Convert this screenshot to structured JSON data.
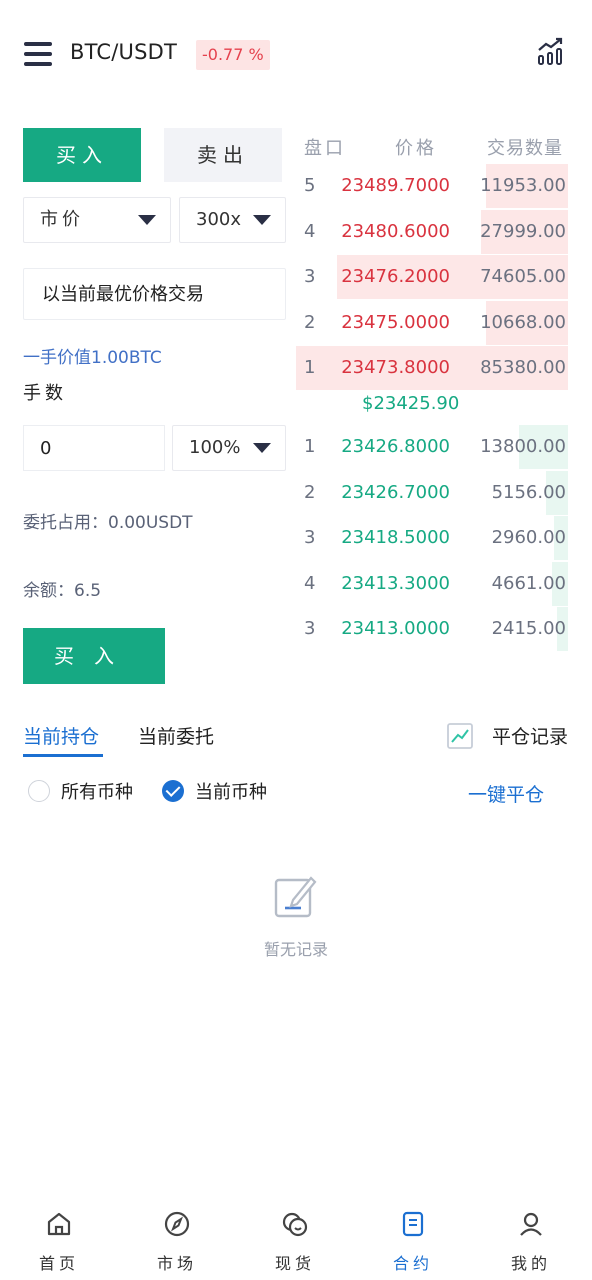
{
  "header": {
    "pair": "BTC/USDT",
    "change": "-0.77 %"
  },
  "trade": {
    "buy_tab": "买入",
    "sell_tab": "卖出",
    "order_type": "市价",
    "leverage": "300x",
    "best_price_text": "以当前最优价格交易",
    "lot_value": "一手价值1.00BTC",
    "qty_label": "手数",
    "qty_value": "0",
    "percent": "100%",
    "margin_used": "委托占用：0.00USDT",
    "balance": "余额：6.5",
    "buy_button": "买入"
  },
  "orderbook": {
    "headers": [
      "盘口",
      "价格",
      "交易数量"
    ],
    "asks": [
      {
        "idx": "5",
        "price": "23489.7000",
        "qty": "11953.00",
        "depth": 0.3
      },
      {
        "idx": "4",
        "price": "23480.6000",
        "qty": "27999.00",
        "depth": 0.32
      },
      {
        "idx": "3",
        "price": "23476.2000",
        "qty": "74605.00",
        "depth": 0.85
      },
      {
        "idx": "2",
        "price": "23475.0000",
        "qty": "10668.00",
        "depth": 0.3
      },
      {
        "idx": "1",
        "price": "23473.8000",
        "qty": "85380.00",
        "depth": 1.0
      }
    ],
    "last_price": "$23425.90",
    "bids": [
      {
        "idx": "1",
        "price": "23426.8000",
        "qty": "13800.00",
        "depth": 0.18
      },
      {
        "idx": "2",
        "price": "23426.7000",
        "qty": "5156.00",
        "depth": 0.08
      },
      {
        "idx": "3",
        "price": "23418.5000",
        "qty": "2960.00",
        "depth": 0.05
      },
      {
        "idx": "4",
        "price": "23413.3000",
        "qty": "4661.00",
        "depth": 0.06
      },
      {
        "idx": "3",
        "price": "23413.0000",
        "qty": "2415.00",
        "depth": 0.04
      }
    ]
  },
  "positions": {
    "tab_current_positions": "当前持仓",
    "tab_current_orders": "当前委托",
    "close_record": "平仓记录",
    "filter_all": "所有币种",
    "filter_current": "当前币种",
    "close_all": "一键平仓",
    "empty_text": "暂无记录"
  },
  "nav": {
    "home": "首页",
    "market": "市场",
    "spot": "现货",
    "contract": "合约",
    "mine": "我的"
  },
  "colors": {
    "green": "#16a983",
    "red": "#d9333f",
    "blue": "#1b6fd1"
  }
}
